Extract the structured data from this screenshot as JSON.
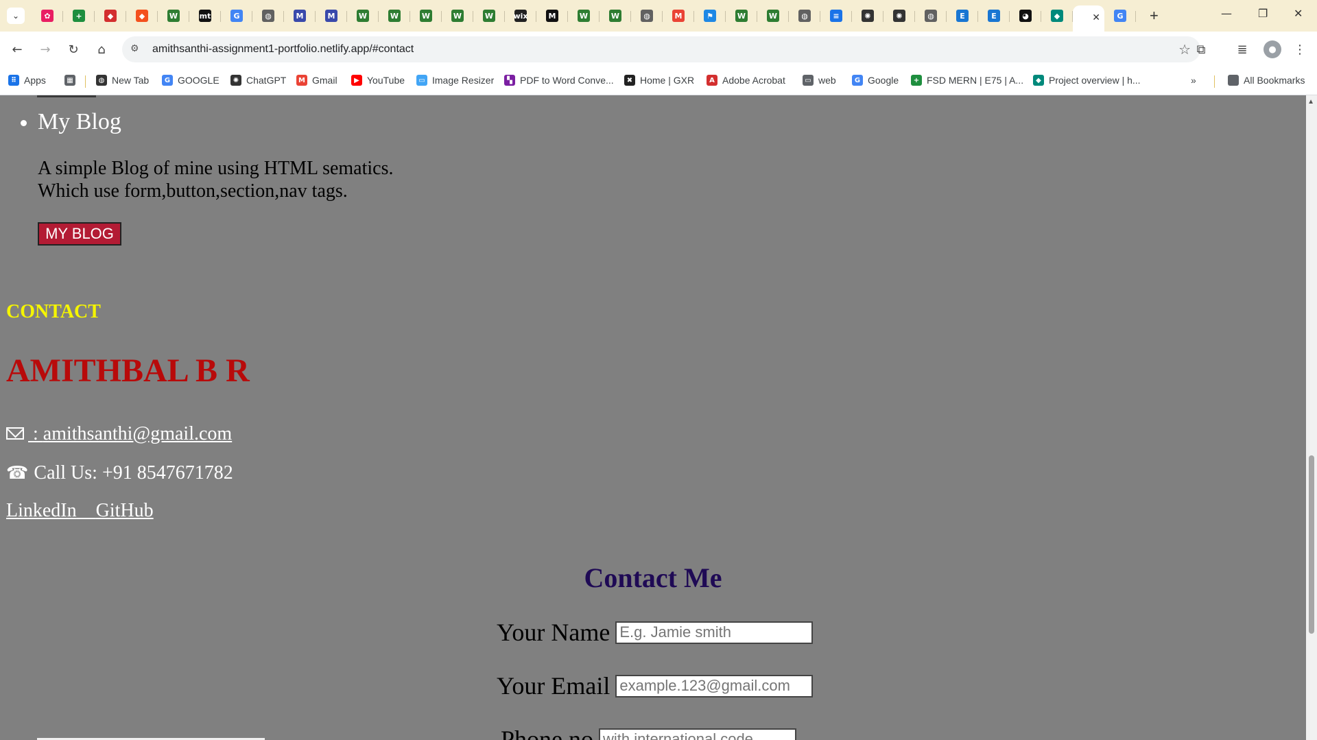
{
  "browser": {
    "tabs": [
      {
        "icon": "tab-favicon-1",
        "color": "#e91e63",
        "glyph": "✿"
      },
      {
        "icon": "sheets-icon",
        "color": "#1e8e3e",
        "glyph": "+"
      },
      {
        "icon": "tab-favicon-3",
        "color": "#d32f2f",
        "glyph": "◆"
      },
      {
        "icon": "tab-favicon-4",
        "color": "#f4511e",
        "glyph": "◆"
      },
      {
        "icon": "w-icon",
        "color": "#2e7d32",
        "glyph": "W"
      },
      {
        "icon": "mt-icon",
        "color": "#111111",
        "glyph": "mt"
      },
      {
        "icon": "google-icon",
        "color": "#4285f4",
        "glyph": "G"
      },
      {
        "icon": "globe-icon",
        "color": "#616161",
        "glyph": "◍"
      },
      {
        "icon": "m-icon",
        "color": "#3949ab",
        "glyph": "M"
      },
      {
        "icon": "m-icon",
        "color": "#3949ab",
        "glyph": "M"
      },
      {
        "icon": "w-icon",
        "color": "#2e7d32",
        "glyph": "W"
      },
      {
        "icon": "w-icon",
        "color": "#2e7d32",
        "glyph": "W"
      },
      {
        "icon": "w-icon",
        "color": "#2e7d32",
        "glyph": "W"
      },
      {
        "icon": "w-icon",
        "color": "#2e7d32",
        "glyph": "W"
      },
      {
        "icon": "w-icon",
        "color": "#2e7d32",
        "glyph": "W"
      },
      {
        "icon": "wix-icon",
        "color": "#212121",
        "glyph": "wix"
      },
      {
        "icon": "m-icon",
        "color": "#111111",
        "glyph": "M"
      },
      {
        "icon": "w-icon",
        "color": "#2e7d32",
        "glyph": "W"
      },
      {
        "icon": "w-icon",
        "color": "#2e7d32",
        "glyph": "W"
      },
      {
        "icon": "globe-icon",
        "color": "#616161",
        "glyph": "◍"
      },
      {
        "icon": "gmail-icon",
        "color": "#ea4335",
        "glyph": "M"
      },
      {
        "icon": "flag-icon",
        "color": "#1e88e5",
        "glyph": "⚑"
      },
      {
        "icon": "w-icon",
        "color": "#2e7d32",
        "glyph": "W"
      },
      {
        "icon": "w-icon",
        "color": "#2e7d32",
        "glyph": "W"
      },
      {
        "icon": "globe-icon",
        "color": "#616161",
        "glyph": "◍"
      },
      {
        "icon": "docs-icon",
        "color": "#1a73e8",
        "glyph": "≡"
      },
      {
        "icon": "openai-icon",
        "color": "#333333",
        "glyph": "✺"
      },
      {
        "icon": "openai-icon",
        "color": "#333333",
        "glyph": "✺"
      },
      {
        "icon": "globe-icon",
        "color": "#616161",
        "glyph": "◍"
      },
      {
        "icon": "e-icon",
        "color": "#1976d2",
        "glyph": "E"
      },
      {
        "icon": "e-icon",
        "color": "#1976d2",
        "glyph": "E"
      },
      {
        "icon": "github-icon",
        "color": "#111111",
        "glyph": "◕"
      },
      {
        "icon": "diamond-icon",
        "color": "#00897b",
        "glyph": "◆"
      },
      {
        "icon": "active-tab-icon",
        "color": "#ffffff",
        "glyph": ""
      },
      {
        "icon": "google-icon",
        "color": "#4285f4",
        "glyph": "G"
      }
    ],
    "tab_close": "✕",
    "new_tab": "+",
    "minimize": "—",
    "restore": "❐",
    "close": "✕",
    "url": "amithsanthi-assignment1-portfolio.netlify.app/#contact",
    "bookmarks": [
      {
        "label": "Apps",
        "icon": "apps-grid-icon",
        "color": "#1a73e8",
        "glyph": "⠿"
      },
      {
        "label": "",
        "icon": "tab-groups-icon",
        "color": "#5f6368",
        "glyph": "▦"
      },
      {
        "label": "New Tab",
        "icon": "chrome-icon",
        "color": "#333333",
        "glyph": "◍"
      },
      {
        "label": "GOOGLE",
        "icon": "google-icon",
        "color": "#4285f4",
        "glyph": "G"
      },
      {
        "label": "ChatGPT",
        "icon": "openai-icon",
        "color": "#333333",
        "glyph": "✺"
      },
      {
        "label": "Gmail",
        "icon": "gmail-icon",
        "color": "#ea4335",
        "glyph": "M"
      },
      {
        "label": "YouTube",
        "icon": "youtube-icon",
        "color": "#ff0000",
        "glyph": "▶"
      },
      {
        "label": "Image Resizer",
        "icon": "image-icon",
        "color": "#42a5f5",
        "glyph": "▭"
      },
      {
        "label": "PDF to Word Conve...",
        "icon": "pdf-word-icon",
        "color": "#7b1fa2",
        "glyph": "▚"
      },
      {
        "label": "Home | GXR",
        "icon": "gxr-icon",
        "color": "#222222",
        "glyph": "✖"
      },
      {
        "label": "Adobe Acrobat",
        "icon": "acrobat-icon",
        "color": "#d32f2f",
        "glyph": "A"
      },
      {
        "label": "web",
        "icon": "folder-icon",
        "color": "#5f6368",
        "glyph": "▭"
      },
      {
        "label": "Google",
        "icon": "google-icon",
        "color": "#4285f4",
        "glyph": "G"
      },
      {
        "label": "FSD MERN | E75 | A...",
        "icon": "sheets-icon",
        "color": "#1e8e3e",
        "glyph": "+"
      },
      {
        "label": "Project overview | h...",
        "icon": "diamond-icon",
        "color": "#00897b",
        "glyph": "◆"
      }
    ],
    "more_bookmarks": "»",
    "all_bookmarks": "All Bookmarks"
  },
  "project": {
    "title": "My Blog",
    "desc_line1": "A simple Blog of mine using HTML sematics.",
    "desc_line2": "Which use form,button,section,nav tags.",
    "button": "MY BLOG"
  },
  "contact": {
    "heading": "CONTACT",
    "name": "AMITHBAL B R",
    "email_prefix": " : ",
    "email": "amithsanthi@gmail.com",
    "phone": "Call Us: +91 8547671782",
    "linkedin": "LinkedIn",
    "github": "GitHub"
  },
  "form": {
    "heading": "Contact Me",
    "name_label": "Your Name",
    "name_placeholder": "E.g. Jamie smith",
    "email_label": "Your Email",
    "email_placeholder": "example.123@gmail.com",
    "phone_label": "Phone no",
    "phone_placeholder": "with international code"
  },
  "colors": {
    "page_bg": "#808080",
    "contact_heading": "#f5f500",
    "name": "#b80a0a",
    "button_bg": "#b31b34",
    "form_heading": "#1f0a55"
  }
}
